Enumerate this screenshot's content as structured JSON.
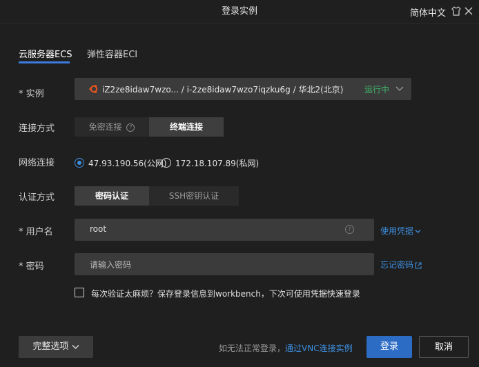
{
  "title": "登录实例",
  "lang_label": "简体中文",
  "tabs": [
    {
      "label": "云服务器ECS",
      "active": true
    },
    {
      "label": "弹性容器ECI",
      "active": false
    }
  ],
  "instance": {
    "label": "实例",
    "value": "iZ2ze8idaw7wzo... / i-2ze8idaw7wzo7iqzku6g / 华北2(北京)",
    "status": "运行中"
  },
  "connection": {
    "label": "连接方式",
    "options": [
      "免密连接",
      "终端连接"
    ],
    "selected": "终端连接"
  },
  "network": {
    "label": "网络连接",
    "options": [
      "47.93.190.56(公网)",
      "172.18.107.89(私网)"
    ],
    "selected": "47.93.190.56(公网)"
  },
  "auth": {
    "label": "认证方式",
    "options": [
      "密码认证",
      "SSH密钥认证"
    ],
    "selected": "密码认证"
  },
  "username": {
    "label": "用户名",
    "value": "root",
    "link": "使用凭据"
  },
  "password": {
    "label": "密码",
    "placeholder": "请输入密码",
    "link": "忘记密码"
  },
  "remember": {
    "label": "每次验证太麻烦？保存登录信息到workbench，下次可使用凭据快速登录",
    "checked": false
  },
  "footer": {
    "options_button": "完整选项",
    "hint": "如无法正常登录，",
    "vnc_link": "通过VNC连接实例",
    "login_button": "登录",
    "cancel_button": "取消"
  },
  "colors": {
    "accent": "#3d8fe0",
    "primary_button": "#2d6cc4",
    "status_green": "#3fb86b",
    "background": "#1f1f1f"
  }
}
